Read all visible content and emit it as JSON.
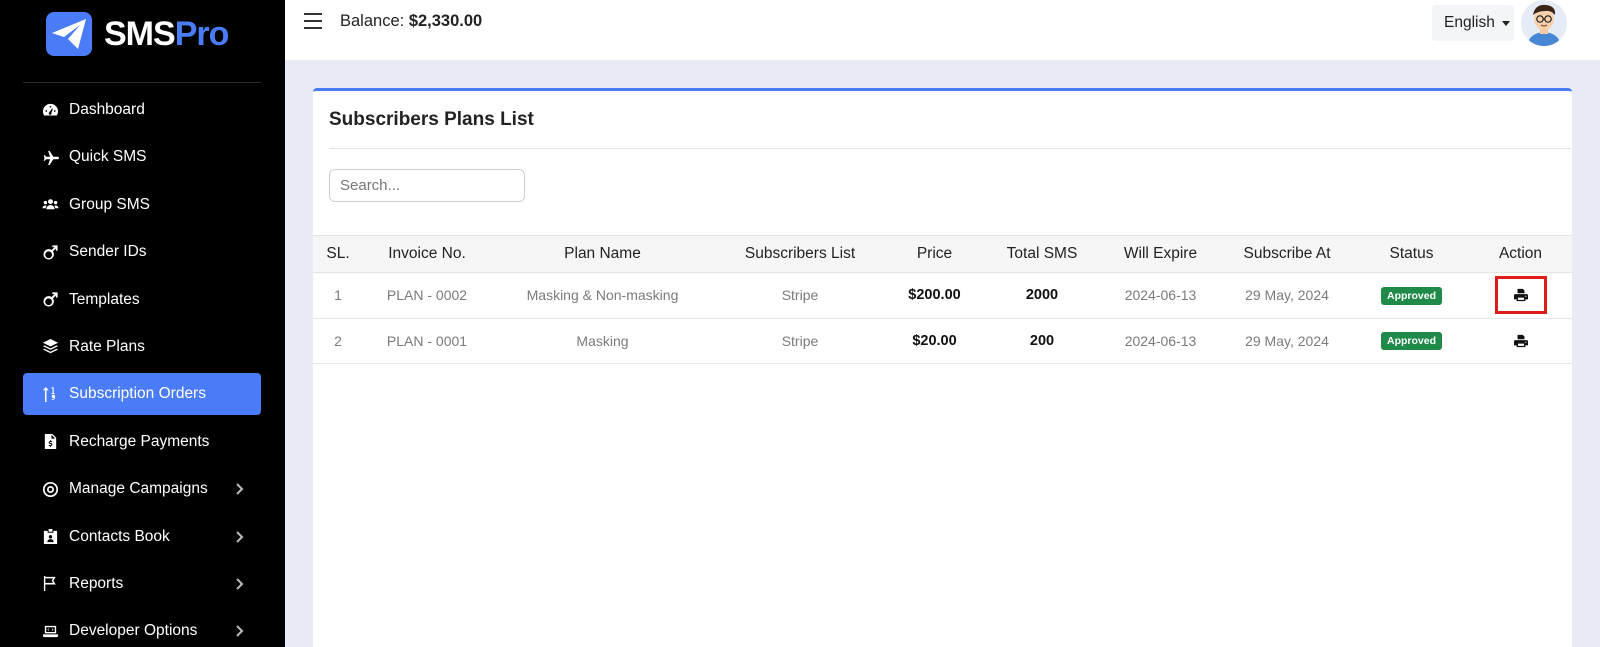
{
  "brand": {
    "name_part1": "SMS",
    "name_part2": "Pro",
    "accent": "#4a7cf7"
  },
  "sidebar": {
    "items": [
      {
        "label": "Dashboard",
        "icon": "speedometer-icon",
        "active": false,
        "has_submenu": false
      },
      {
        "label": "Quick SMS",
        "icon": "plane-icon",
        "active": false,
        "has_submenu": false
      },
      {
        "label": "Group SMS",
        "icon": "users-icon",
        "active": false,
        "has_submenu": false
      },
      {
        "label": "Sender IDs",
        "icon": "male-icon",
        "active": false,
        "has_submenu": false
      },
      {
        "label": "Templates",
        "icon": "male-icon",
        "active": false,
        "has_submenu": false
      },
      {
        "label": "Rate Plans",
        "icon": "layers-icon",
        "active": false,
        "has_submenu": false
      },
      {
        "label": "Subscription Orders",
        "icon": "sort-icon",
        "active": true,
        "has_submenu": false
      },
      {
        "label": "Recharge Payments",
        "icon": "invoice-dollar-icon",
        "active": false,
        "has_submenu": false
      },
      {
        "label": "Manage Campaigns",
        "icon": "bullseye-icon",
        "active": false,
        "has_submenu": true
      },
      {
        "label": "Contacts Book",
        "icon": "id-badge-icon",
        "active": false,
        "has_submenu": true
      },
      {
        "label": "Reports",
        "icon": "flag-icon",
        "active": false,
        "has_submenu": true
      },
      {
        "label": "Developer Options",
        "icon": "laptop-code-icon",
        "active": false,
        "has_submenu": true
      }
    ]
  },
  "topbar": {
    "balance_label": "Balance:",
    "balance_value": "$2,330.00",
    "language": "English"
  },
  "card": {
    "title": "Subscribers Plans List",
    "search_placeholder": "Search..."
  },
  "table": {
    "columns": [
      "SL.",
      "Invoice No.",
      "Plan Name",
      "Subscribers List",
      "Price",
      "Total SMS",
      "Will Expire",
      "Subscribe At",
      "Status",
      "Action"
    ],
    "rows": [
      {
        "sl": "1",
        "invoice": "PLAN - 0002",
        "plan": "Masking & Non-masking",
        "subscribers": "Stripe",
        "price": "$200.00",
        "total_sms": "2000",
        "expire": "2024-06-13",
        "subscribe_at": "29 May, 2024",
        "status": "Approved",
        "highlighted": true
      },
      {
        "sl": "2",
        "invoice": "PLAN - 0001",
        "plan": "Masking",
        "subscribers": "Stripe",
        "price": "$20.00",
        "total_sms": "200",
        "expire": "2024-06-13",
        "subscribe_at": "29 May, 2024",
        "status": "Approved",
        "highlighted": false
      }
    ]
  },
  "colors": {
    "status_approved": "#1f8a49",
    "highlight": "#e01b1b"
  }
}
